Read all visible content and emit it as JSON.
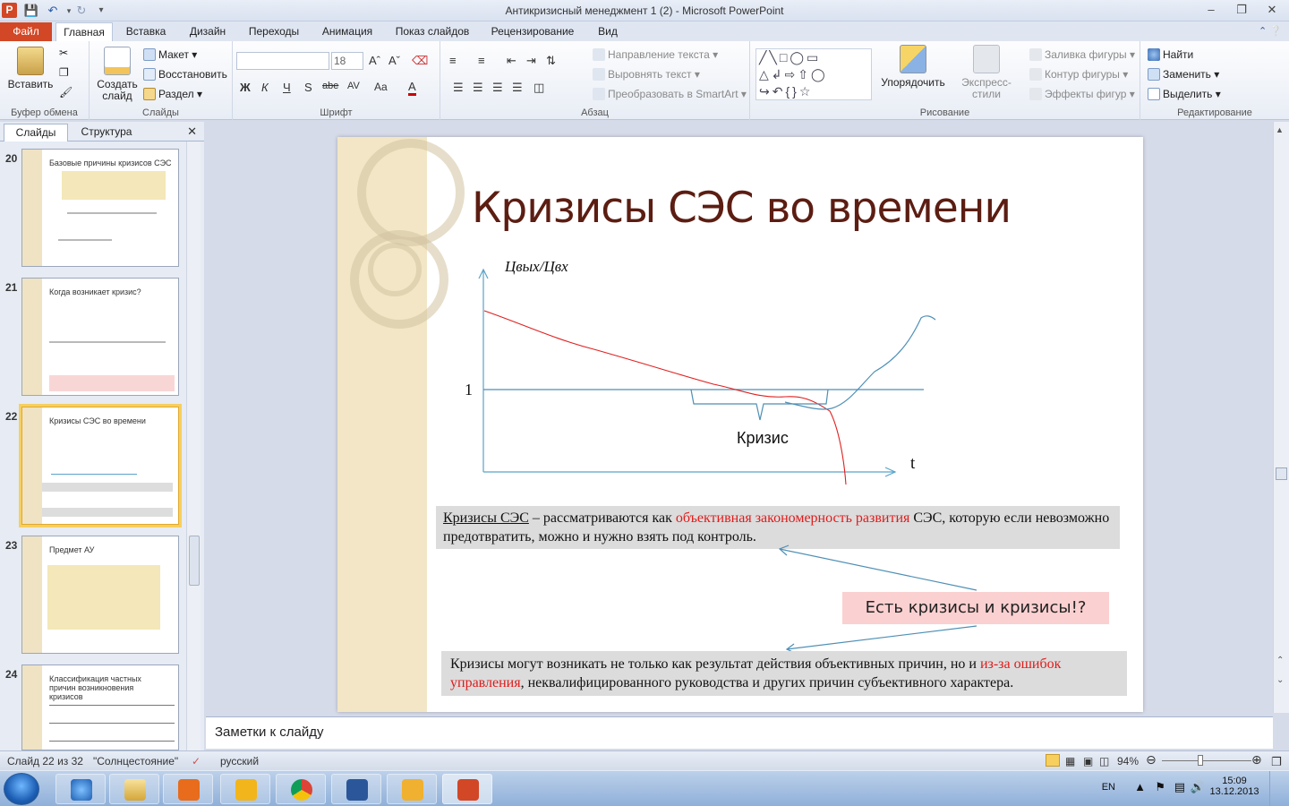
{
  "window": {
    "title": "Антикризисный менеджмент 1 (2)  -  Microsoft PowerPoint",
    "app_icon": "P"
  },
  "tabs": {
    "file": "Файл",
    "items": [
      "Главная",
      "Вставка",
      "Дизайн",
      "Переходы",
      "Анимация",
      "Показ слайдов",
      "Рецензирование",
      "Вид"
    ],
    "active": "Главная"
  },
  "ribbon": {
    "clipboard": {
      "paste": "Вставить",
      "label": "Буфер обмена"
    },
    "slides": {
      "new_slide": "Создать слайд",
      "layout": "Макет",
      "reset": "Восстановить",
      "section": "Раздел",
      "label": "Слайды"
    },
    "font": {
      "size": "18",
      "label": "Шрифт",
      "bold": "Ж",
      "italic": "К",
      "underline": "Ч",
      "strike": "abe",
      "spacing": "AV",
      "case": "Aa"
    },
    "paragraph": {
      "text_direction": "Направление текста",
      "align_text": "Выровнять текст",
      "smartart": "Преобразовать в SmartArt",
      "label": "Абзац"
    },
    "drawing": {
      "arrange": "Упорядочить",
      "quick_styles": "Экспресс-стили",
      "fill": "Заливка фигуры",
      "outline": "Контур фигуры",
      "effects": "Эффекты фигур",
      "label": "Рисование"
    },
    "editing": {
      "find": "Найти",
      "replace": "Заменить",
      "select": "Выделить",
      "label": "Редактирование"
    }
  },
  "left_pane": {
    "tab_slides": "Слайды",
    "tab_outline": "Структура",
    "thumbnails": [
      {
        "num": "20",
        "title": "Базовые  причины кризисов СЭС"
      },
      {
        "num": "21",
        "title": "Когда возникает кризис?"
      },
      {
        "num": "22",
        "title": "Кризисы  СЭС во времени"
      },
      {
        "num": "23",
        "title": "Предмет АУ"
      },
      {
        "num": "24",
        "title": "Классификация частных причин возникновения кризисов"
      }
    ]
  },
  "slide": {
    "title": "Кризисы СЭС во времени",
    "chart": {
      "y_axis_label": "Цвых/Цвх",
      "y_tick": "1",
      "x_axis_label": "t",
      "brace_label": "Кризис"
    },
    "box1": {
      "underlined": "Кризисы СЭС",
      "text1": " – рассматриваются как ",
      "highlight": "объективная закономерность развития",
      "text2": " СЭС, которую если невозможно предотвратить, можно и нужно взять под контроль."
    },
    "callout": "Есть кризисы и кризисы!?",
    "box2": {
      "text1": "Кризисы могут возникать не только как результат действия объективных причин, но и ",
      "highlight": "из-за ошибок управления",
      "text2": ", неквалифицированного руководства и других причин субъективного характера."
    }
  },
  "notes": {
    "placeholder": "Заметки к слайду"
  },
  "status": {
    "slide_info": "Слайд 22 из 32",
    "theme": "\"Солнцестояние\"",
    "language": "русский",
    "zoom": "94%"
  },
  "taskbar": {
    "lang": "EN",
    "time": "15:09",
    "date": "13.12.2013"
  },
  "colors": {
    "accent_file": "#d24726",
    "slide_title": "#5c1d12",
    "red_text": "#e01b1b",
    "axis": "#5aa4c9"
  }
}
